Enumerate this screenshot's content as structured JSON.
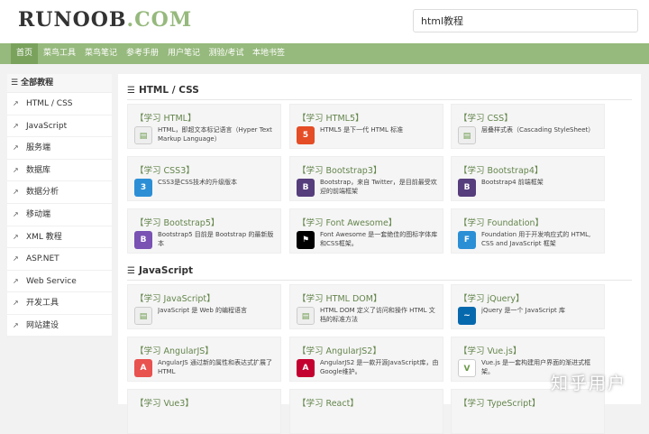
{
  "logo": {
    "part1": "RUNOOB",
    "part2": ".COM"
  },
  "search": {
    "value": "html教程"
  },
  "nav": [
    "首页",
    "菜鸟工具",
    "菜鸟笔记",
    "参考手册",
    "用户笔记",
    "测验/考试",
    "本地书签"
  ],
  "sidebar": {
    "header": "全部教程",
    "items": [
      {
        "label": "HTML / CSS",
        "icon": "external-link-icon"
      },
      {
        "label": "JavaScript",
        "icon": "external-link-icon"
      },
      {
        "label": "服务端",
        "icon": "external-link-icon"
      },
      {
        "label": "数据库",
        "icon": "external-link-icon"
      },
      {
        "label": "数据分析",
        "icon": "external-link-icon"
      },
      {
        "label": "移动端",
        "icon": "external-link-icon"
      },
      {
        "label": "XML 教程",
        "icon": "external-link-icon"
      },
      {
        "label": "ASP.NET",
        "icon": "external-link-icon"
      },
      {
        "label": "Web Service",
        "icon": "external-link-icon"
      },
      {
        "label": "开发工具",
        "icon": "external-link-icon"
      },
      {
        "label": "网站建设",
        "icon": "external-link-icon"
      }
    ]
  },
  "sections": [
    {
      "title": "HTML / CSS",
      "cards": [
        {
          "title": "【学习 HTML】",
          "desc": "HTML，即超文本标记语言（Hyper Text Markup Language）",
          "icon": "html-doc-icon",
          "color": "#eeeeee",
          "glyph": ""
        },
        {
          "title": "【学习 HTML5】",
          "desc": "HTML5 是下一代 HTML 标准",
          "icon": "html5-icon",
          "color": "#e44d26",
          "glyph": "5"
        },
        {
          "title": "【学习 CSS】",
          "desc": "层叠样式表（Cascading StyleSheet）",
          "icon": "css-doc-icon",
          "color": "#eeeeee",
          "glyph": ""
        },
        {
          "title": "【学习 CSS3】",
          "desc": "CSS3是CSS技术的升级版本",
          "icon": "css3-icon",
          "color": "#2c8fd6",
          "glyph": "3"
        },
        {
          "title": "【学习 Bootstrap3】",
          "desc": "Bootstrap，来自 Twitter，是目前最受欢迎的前端框架",
          "icon": "bootstrap-icon",
          "color": "#563d7c",
          "glyph": "B"
        },
        {
          "title": "【学习 Bootstrap4】",
          "desc": "Bootstrap4 前端框架",
          "icon": "bootstrap-icon",
          "color": "#563d7c",
          "glyph": "B"
        },
        {
          "title": "【学习 Bootstrap5】",
          "desc": "Bootstrap5 目前是 Bootstrap 的最新版本",
          "icon": "bootstrap-icon",
          "color": "#7952b3",
          "glyph": "B"
        },
        {
          "title": "【学习 Font Awesome】",
          "desc": "Font Awesome 是一套绝佳的图标字体库和CSS框架。",
          "icon": "font-awesome-flag-icon",
          "color": "#000000",
          "glyph": "⚑"
        },
        {
          "title": "【学习 Foundation】",
          "desc": "Foundation 用于开发响应式的 HTML, CSS and JavaScript 框架",
          "icon": "foundation-icon",
          "color": "#2b8fd6",
          "glyph": "F"
        }
      ]
    },
    {
      "title": "JavaScript",
      "cards": [
        {
          "title": "【学习 JavaScript】",
          "desc": "JavaScript 是 Web 的编程语言",
          "icon": "javascript-doc-icon",
          "color": "#eeeeee",
          "glyph": ""
        },
        {
          "title": "【学习 HTML DOM】",
          "desc": "HTML DOM 定义了访问和操作 HTML 文档的标准方法",
          "icon": "dom-doc-icon",
          "color": "#eeeeee",
          "glyph": ""
        },
        {
          "title": "【学习 jQuery】",
          "desc": "jQuery 是一个 JavaScript 库",
          "icon": "jquery-icon",
          "color": "#0769ad",
          "glyph": "~"
        },
        {
          "title": "【学习 AngularJS】",
          "desc": "AngularJS 通过新的属性和表达式扩展了 HTML",
          "icon": "angularjs-icon",
          "color": "#e8524f",
          "glyph": "A"
        },
        {
          "title": "【学习 AngularJS2】",
          "desc": "AngularJS2 是一款开源JavaScript库，由Google维护。",
          "icon": "angularjs2-icon",
          "color": "#c3002f",
          "glyph": "A"
        },
        {
          "title": "【学习 Vue.js】",
          "desc": "Vue.js 是一套构建用户界面的渐进式框架。",
          "icon": "vue-icon",
          "color": "#ffffff",
          "glyph": "V"
        },
        {
          "title": "【学习 Vue3】",
          "desc": "",
          "icon": "",
          "color": "",
          "glyph": ""
        },
        {
          "title": "【学习 React】",
          "desc": "",
          "icon": "",
          "color": "",
          "glyph": ""
        },
        {
          "title": "【学习 TypeScript】",
          "desc": "",
          "icon": "",
          "color": "",
          "glyph": ""
        }
      ]
    }
  ],
  "watermark": "知乎用户"
}
